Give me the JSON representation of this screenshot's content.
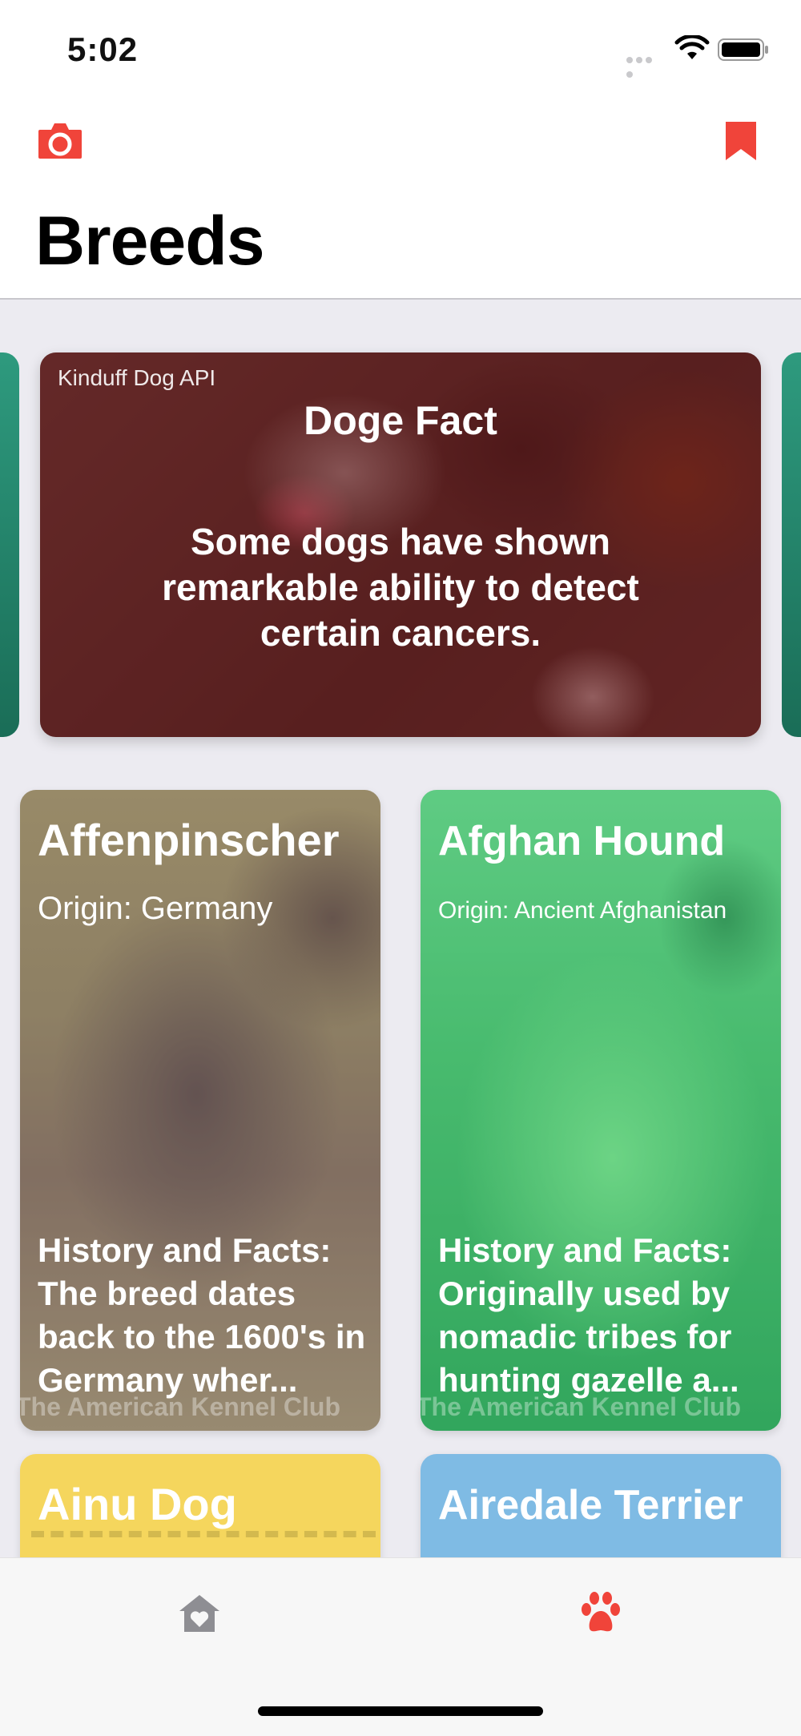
{
  "status_bar": {
    "time": "5:02"
  },
  "nav": {
    "title": "Breeds",
    "camera_icon": "camera-icon",
    "bookmark_icon": "bookmark-icon",
    "accent": "#f0443a"
  },
  "fact_card": {
    "source": "Kinduff Dog API",
    "title": "Doge Fact",
    "text": "Some dogs have shown remarkable ability to detect certain cancers."
  },
  "breeds": [
    {
      "name": "Affenpinscher",
      "origin": "Origin: Germany",
      "history": "History and Facts: The breed dates back to the 1600's in Germany wher...",
      "credit": "The American Kennel Club"
    },
    {
      "name": "Afghan Hound",
      "origin": "Origin: Ancient Afghanistan",
      "history": "History and Facts: Originally used by nomadic tribes for hunting gazelle a...",
      "credit": "The American Kennel Club"
    },
    {
      "name": "Ainu Dog"
    },
    {
      "name": "Airedale Terrier"
    }
  ],
  "tab_bar": {
    "items": [
      {
        "icon": "home-heart-icon",
        "selected": false
      },
      {
        "icon": "paw-icon",
        "selected": true
      }
    ]
  }
}
